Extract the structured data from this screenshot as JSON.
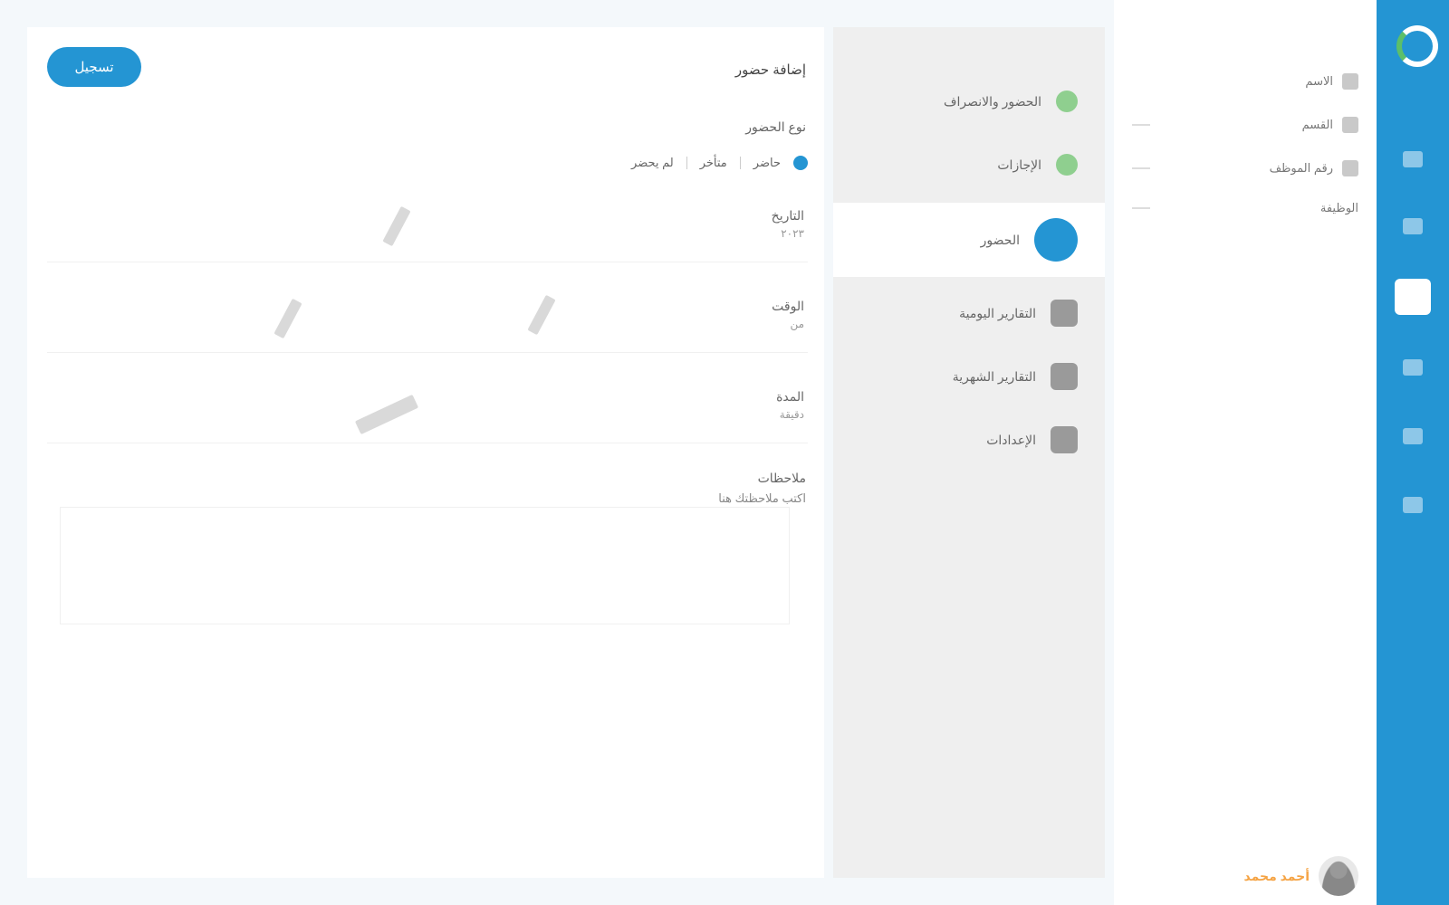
{
  "main": {
    "primary_button": "تسجيل",
    "title": "إضافة حضور",
    "subtitle": "نوع الحضور",
    "filters": [
      "لم يحضر",
      "متأخر",
      "حاضر"
    ],
    "fields": [
      {
        "label": "التاريخ",
        "sub": "٢٠٢٣"
      },
      {
        "label": "الوقت",
        "sub": "من"
      },
      {
        "label": "المدة",
        "sub": "دقيقة"
      }
    ],
    "notes_label": "ملاحظات",
    "notes_sub": "اكتب ملاحظتك هنا"
  },
  "submenu": {
    "items": [
      {
        "label": "الحضور والانصراف",
        "badge": "green"
      },
      {
        "label": "الإجازات",
        "badge": "green"
      },
      {
        "label": "الحضور",
        "badge": "active"
      },
      {
        "label": "التقارير اليومية",
        "badge": "gray"
      },
      {
        "label": "التقارير الشهرية",
        "badge": "gray"
      },
      {
        "label": "الإعدادات",
        "badge": "gray"
      }
    ]
  },
  "info": {
    "rows": [
      "الاسم",
      "القسم",
      "رقم الموظف",
      "الوظيفة"
    ]
  },
  "user": {
    "name": "أحمد محمد"
  },
  "rail": {
    "icons": [
      "dashboard-icon",
      "users-icon",
      "attendance-icon",
      "calendar-icon",
      "reports-icon",
      "settings-icon"
    ]
  },
  "colors": {
    "accent": "#2495d3",
    "success": "#5cbf6a",
    "user_name": "#f5a445"
  }
}
